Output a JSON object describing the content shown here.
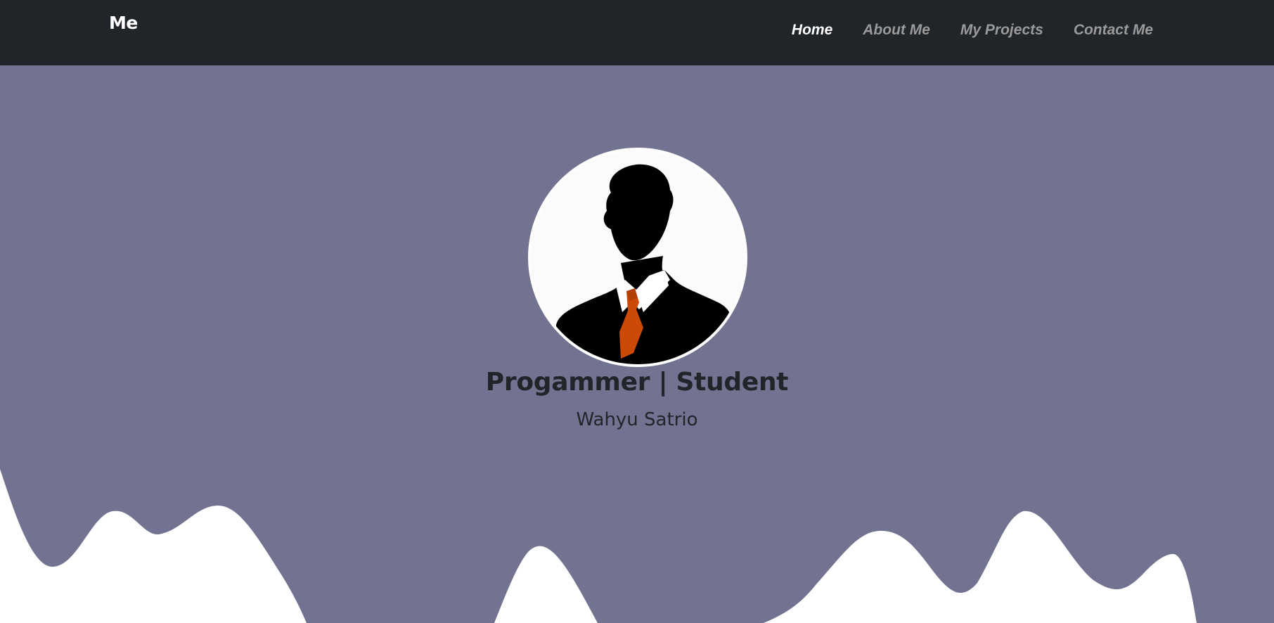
{
  "navbar": {
    "brand": "Me",
    "links": [
      {
        "label": "Home",
        "active": true
      },
      {
        "label": "About Me",
        "active": false
      },
      {
        "label": "My Projects",
        "active": false
      },
      {
        "label": "Contact Me",
        "active": false
      }
    ]
  },
  "hero": {
    "avatar_icon": "person-silhouette-icon",
    "title": "Progammer | Student",
    "name": "Wahyu Satrio"
  },
  "colors": {
    "navbar_bg": "#212529",
    "hero_bg": "#727291",
    "wave": "#ffffff",
    "tie": "#cc4a05",
    "text_dark": "#212529",
    "link_active": "#ffffff",
    "link_inactive": "#9a9a9a"
  }
}
